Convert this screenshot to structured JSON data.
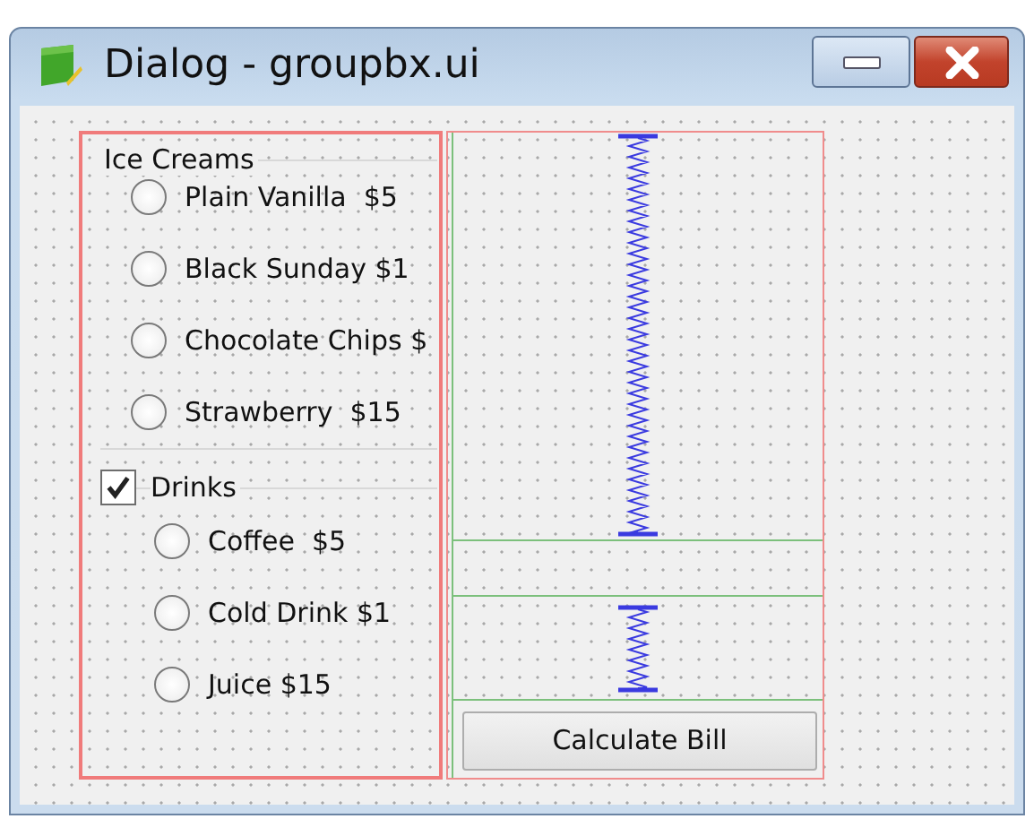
{
  "window": {
    "title": "Dialog - groupbx.ui"
  },
  "ice_creams": {
    "title": "Ice Creams",
    "options": [
      {
        "label": "Plain Vanilla  $5",
        "selected": false
      },
      {
        "label": "Black Sunday $1",
        "selected": false
      },
      {
        "label": "Chocolate Chips $",
        "selected": false
      },
      {
        "label": "Strawberry  $15",
        "selected": false
      }
    ]
  },
  "drinks": {
    "title": "Drinks",
    "checked": true,
    "options": [
      {
        "label": "Coffee  $5",
        "selected": false
      },
      {
        "label": "Cold Drink $1",
        "selected": false
      },
      {
        "label": "Juice $15",
        "selected": false
      }
    ]
  },
  "buttons": [
    "Calculate Bill"
  ]
}
